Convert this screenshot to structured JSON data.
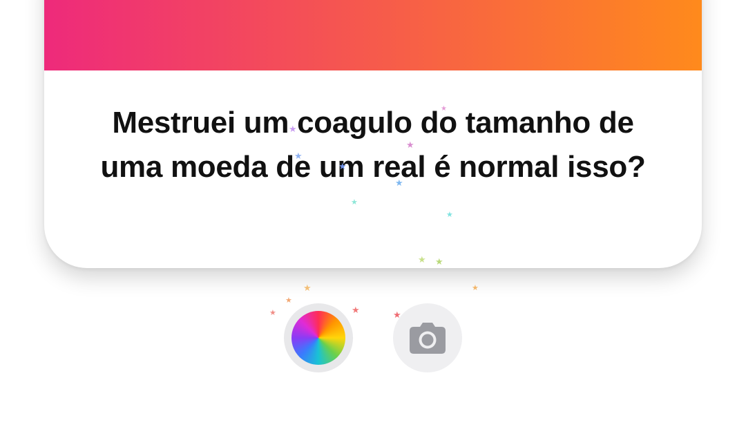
{
  "question": {
    "text": "Mestruei um coagulo do tamanho de uma moeda de um real é normal isso?"
  },
  "header": {
    "gradient_start": "#ee2a7b",
    "gradient_end": "#ff8a1c"
  },
  "controls": {
    "color_picker_icon": "color-wheel-icon",
    "camera_icon": "camera-icon"
  },
  "colors": {
    "camera_icon": "#9a9ba1",
    "button_bg": "#efeff1"
  }
}
